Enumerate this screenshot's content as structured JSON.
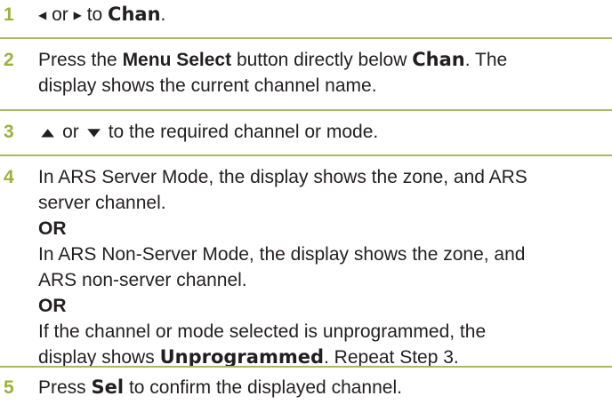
{
  "steps": [
    {
      "number": "1",
      "left_icon": "left-triangle-icon",
      "or": "or",
      "right_icon": "right-triangle-icon",
      "to": "to",
      "target": "Chan",
      "end": "."
    },
    {
      "number": "2",
      "pre": "Press the",
      "button": "Menu Select",
      "mid": "button directly below",
      "target": "Chan",
      "post": ". The",
      "line2": "display shows the current channel name."
    },
    {
      "number": "3",
      "up_icon": "up-arrow-icon",
      "or": "or",
      "down_icon": "down-arrow-icon",
      "rest": "to the required channel or mode."
    },
    {
      "number": "4",
      "l1": "In ARS Server Mode, the display shows the zone, and ARS",
      "l2": "server channel.",
      "or1": "OR",
      "l3": "In ARS Non-Server Mode, the display shows the zone, and",
      "l4": "ARS non-server channel.",
      "or2": "OR",
      "l5": "If the channel or mode selected is unprogrammed, the",
      "l6_pre": "display shows",
      "l6_disp": "Unprogrammed",
      "l6_post": ". Repeat Step 3."
    },
    {
      "number": "5",
      "pre": "Press",
      "key": "Sel",
      "post": "to confirm the displayed channel."
    }
  ],
  "colors": {
    "step_number": "#9bb13a",
    "rule": "#a6b864",
    "text": "#231f20"
  }
}
